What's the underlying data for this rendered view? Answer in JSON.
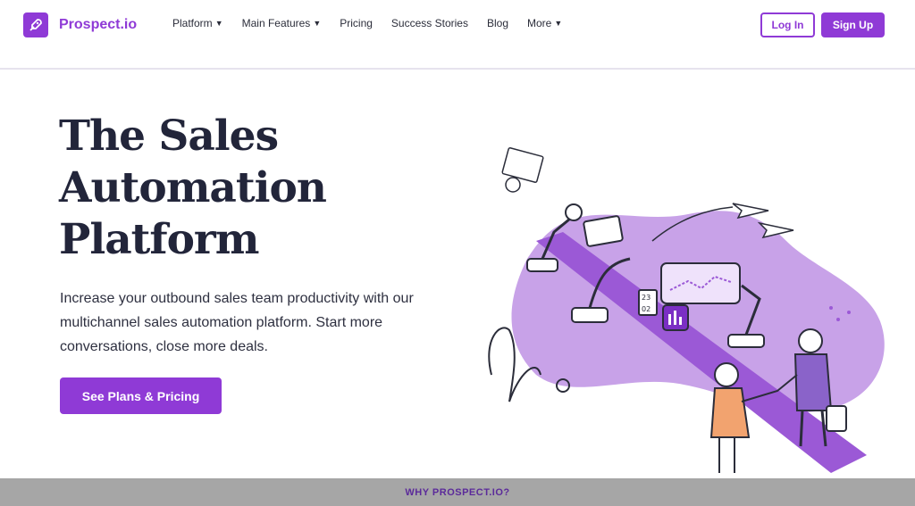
{
  "brand": {
    "name": "Prospect.io",
    "color": "#8f3ad6",
    "icon": "rocket-icon"
  },
  "nav": {
    "items": [
      {
        "label": "Platform",
        "dropdown": true
      },
      {
        "label": "Main Features",
        "dropdown": true
      },
      {
        "label": "Pricing",
        "dropdown": false
      },
      {
        "label": "Success Stories",
        "dropdown": false
      },
      {
        "label": "Blog",
        "dropdown": false
      },
      {
        "label": "More",
        "dropdown": true
      }
    ],
    "login_label": "Log In",
    "signup_label": "Sign Up"
  },
  "hero": {
    "title_line1": "The Sales",
    "title_line2": "Automation",
    "title_line3": "Platform",
    "description": "Increase your outbound sales team productivity with our multichannel sales automation platform. Start more conversations, close more deals.",
    "cta_label": "See Plans & Pricing",
    "illustration_date_top": "23",
    "illustration_date_bottom": "02"
  },
  "footer_band": {
    "label": "WHY PROSPECT.IO?"
  }
}
